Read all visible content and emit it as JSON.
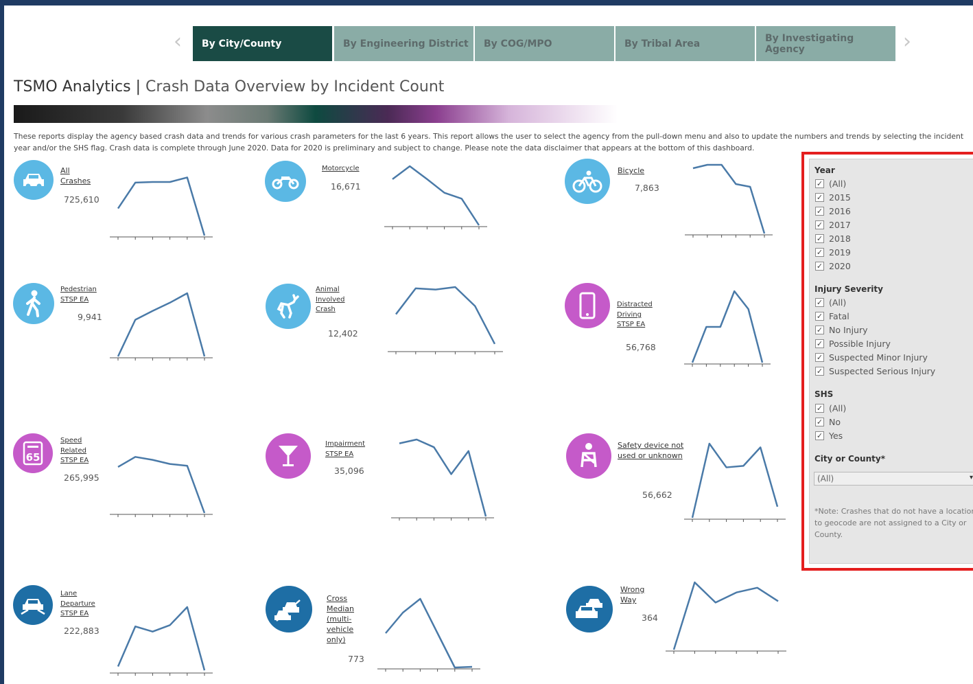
{
  "tabs": {
    "items": [
      {
        "label": "By City/County",
        "active": true
      },
      {
        "label": "By Engineering District",
        "active": false
      },
      {
        "label": "By COG/MPO",
        "active": false
      },
      {
        "label": "By Tribal Area",
        "active": false
      },
      {
        "label": "By Investigating Agency",
        "active": false
      }
    ],
    "prev_arrow": "‹",
    "next_arrow": "›"
  },
  "header": {
    "title_main": "TSMO Analytics | ",
    "title_sub": "Crash Data Overview by Incident Count"
  },
  "description": "These reports display the agency based crash data and trends for various crash parameters for the last 6 years. This report allows the user to select the agency from the pull-down menu and also to update the numbers and trends by selecting the incident year and/or the SHS flag.  Crash data is complete through June 2020.  Data for 2020 is preliminary and subject to change.  Please note the data disclaimer that appears at the bottom of this dashboard.",
  "colors": {
    "tab_active": "#1a4b45",
    "tab_inactive": "#8aaca6",
    "icon_blue": "#5bb8e4",
    "icon_darkblue": "#1e6ea5",
    "icon_magenta": "#c55ac9",
    "sparkline": "#4a7aa8",
    "panel_border": "#e41e1e"
  },
  "metrics": [
    {
      "label": "All\nCrashes",
      "value": "725,610",
      "icon": "car-crash-icon",
      "trend": [
        0.42,
        0.82,
        0.83,
        0.83,
        0.9,
        0.0
      ]
    },
    {
      "label": "Motorcycle",
      "value": "16,671",
      "icon": "motorcycle-icon",
      "trend": [
        0.78,
        1.0,
        0.78,
        0.55,
        0.45,
        0.0
      ]
    },
    {
      "label": "Bicycle",
      "value": "7,863",
      "icon": "bicycle-icon",
      "trend": [
        0.95,
        1.0,
        1.0,
        0.72,
        0.68,
        0.0
      ]
    },
    {
      "label": "Pedestrian\nSTSP EA",
      "value": "9,941",
      "icon": "pedestrian-icon",
      "trend": [
        0.0,
        0.58,
        0.72,
        0.85,
        1.0,
        0.0
      ]
    },
    {
      "label": "Animal\nInvolved\nCrash",
      "value": "12,402",
      "icon": "deer-icon",
      "trend": [
        0.57,
        0.98,
        0.96,
        1.0,
        0.7,
        0.1
      ]
    },
    {
      "label": "Distracted\nDriving\nSTSP EA",
      "value": "56,768",
      "icon": "phone-icon",
      "trend": [
        0.0,
        0.5,
        0.5,
        1.0,
        0.75,
        0.0
      ]
    },
    {
      "label": "Speed\nRelated\nSTSP EA",
      "value": "265,995",
      "icon": "speed-limit-icon",
      "trend": [
        0.78,
        0.95,
        0.9,
        0.83,
        0.8,
        0.0
      ]
    },
    {
      "label": "Impairment\nSTSP EA",
      "value": "35,096",
      "icon": "cocktail-icon",
      "trend": [
        0.95,
        1.0,
        0.9,
        0.55,
        0.85,
        0.0
      ]
    },
    {
      "label": "Safety device not\nused or unknown",
      "value": "56,662",
      "icon": "seatbelt-icon",
      "trend": [
        0.0,
        1.0,
        0.68,
        0.7,
        0.95,
        0.15
      ]
    },
    {
      "label": "Lane\nDeparture\nSTSP EA",
      "value": "222,883",
      "icon": "lane-departure-icon",
      "trend": [
        0.08,
        0.7,
        0.62,
        0.72,
        1.0,
        0.02
      ]
    },
    {
      "label": "Cross\nMedian\n(multi-\nvehicle\nonly)",
      "value": "773",
      "icon": "cross-median-icon",
      "trend": [
        0.5,
        0.8,
        1.0,
        0.5,
        0.0,
        0.01
      ]
    },
    {
      "label": "Wrong\nWay",
      "value": "364",
      "icon": "wrong-way-icon",
      "trend": [
        0.0,
        1.0,
        0.7,
        0.85,
        0.92,
        0.72
      ]
    }
  ],
  "filters": {
    "year": {
      "title": "Year",
      "options": [
        "(All)",
        "2015",
        "2016",
        "2017",
        "2018",
        "2019",
        "2020"
      ]
    },
    "injury": {
      "title": "Injury Severity",
      "options": [
        "(All)",
        "Fatal",
        "No Injury",
        "Possible Injury",
        "Suspected Minor Injury",
        "Suspected Serious Injury"
      ]
    },
    "shs": {
      "title": "SHS",
      "options": [
        "(All)",
        "No",
        "Yes"
      ]
    },
    "city": {
      "title": "City or County*",
      "selected": "(All)"
    },
    "note": "*Note: Crashes that do not have a location to geocode are not assigned to a City or County.",
    "check_glyph": "✓",
    "caret_glyph": "▾"
  }
}
